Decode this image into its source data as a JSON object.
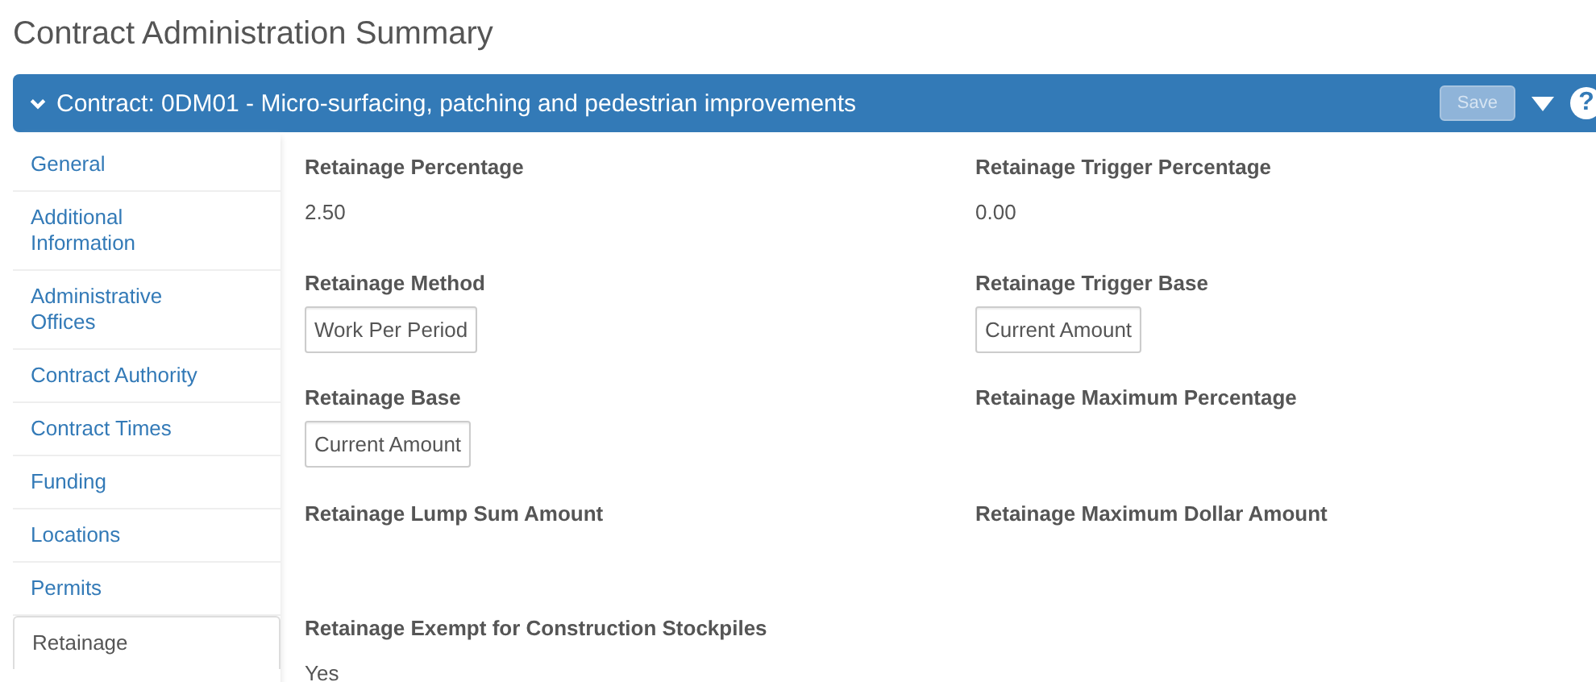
{
  "page_title": "Contract Administration Summary",
  "header": {
    "title": "Contract: 0DM01 - Micro-surfacing, patching and pedestrian improvements",
    "expanded": true,
    "save_label": "Save",
    "save_disabled": true,
    "help_label": "?"
  },
  "sidebar": {
    "items": [
      {
        "label": "General",
        "selected": false
      },
      {
        "label": "Additional Information",
        "selected": false
      },
      {
        "label": "Administrative Offices",
        "selected": false
      },
      {
        "label": "Contract Authority",
        "selected": false
      },
      {
        "label": "Contract Times",
        "selected": false
      },
      {
        "label": "Funding",
        "selected": false
      },
      {
        "label": "Locations",
        "selected": false
      },
      {
        "label": "Permits",
        "selected": false
      },
      {
        "label": "Retainage",
        "selected": true
      }
    ]
  },
  "fields": [
    {
      "label": "Retainage Percentage",
      "kind": "text",
      "value": "2.50"
    },
    {
      "label": "Retainage Trigger Percentage",
      "kind": "text",
      "value": "0.00"
    },
    {
      "label": "Retainage Method",
      "kind": "box",
      "value": "Work Per Period"
    },
    {
      "label": "Retainage Trigger Base",
      "kind": "box",
      "value": "Current Amount"
    },
    {
      "label": "Retainage Base",
      "kind": "box",
      "value": "Current Amount"
    },
    {
      "label": "Retainage Maximum Percentage",
      "kind": "empty"
    },
    {
      "label": "Retainage Lump Sum Amount",
      "kind": "empty"
    },
    {
      "label": "Retainage Maximum Dollar Amount",
      "kind": "empty"
    },
    {
      "label": "Retainage Exempt for Construction Stockpiles",
      "kind": "text",
      "value": "Yes"
    }
  ]
}
